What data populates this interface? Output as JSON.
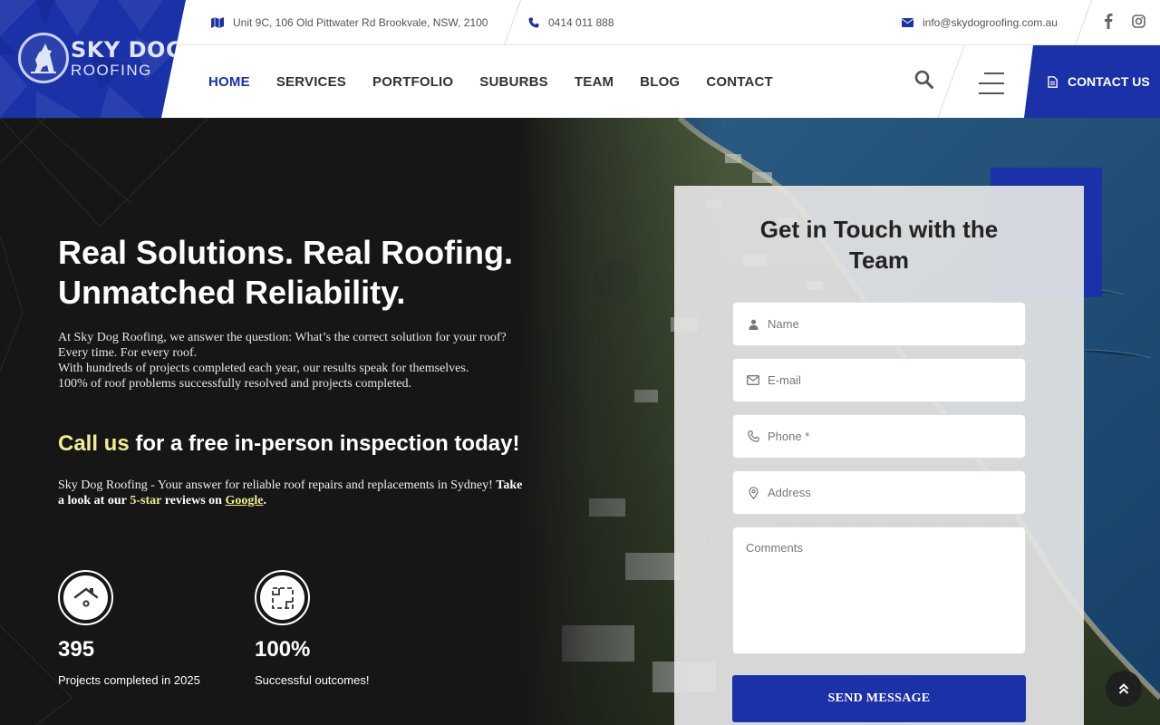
{
  "brand": {
    "line1": "SKY DOG",
    "line2": "ROOFING",
    "accent": "#1a31a8"
  },
  "topbar": {
    "address": "Unit 9C, 106 Old Pittwater Rd Brookvale, NSW, 2100",
    "phone": "0414 011 888",
    "email": "info@skydogroofing.com.au",
    "icons": {
      "address": "map-icon",
      "phone": "phone-icon",
      "email": "envelope-icon",
      "social": [
        "facebook-icon",
        "instagram-icon"
      ]
    }
  },
  "nav": {
    "items": [
      "HOME",
      "SERVICES",
      "PORTFOLIO",
      "SUBURBS",
      "TEAM",
      "BLOG",
      "CONTACT"
    ],
    "active": "HOME",
    "cta_label": "CONTACT US"
  },
  "hero": {
    "title_line1": "Real Solutions. Real Roofing.",
    "title_line2": "Unmatched Reliability.",
    "desc_lines": [
      "At Sky Dog Roofing, we answer the question: What’s the correct solution for your roof?",
      "Every time. For every roof.",
      "With hundreds of projects completed each year, our results speak for themselves.",
      "100% of roof problems successfully resolved and projects completed."
    ],
    "cta_highlight": "Call us",
    "cta_rest": "for a free in-person inspection today!",
    "note_plain": "Sky Dog Roofing - Your answer for reliable roof repairs and replacements in Sydney!",
    "note_bold_prefix": "Take a look at our",
    "note_stars": "5-star",
    "note_reviews_on": "reviews on",
    "note_link": "Google",
    "note_end": "."
  },
  "stats": [
    {
      "value": "395",
      "label": "Projects completed in 2025",
      "icon": "house-icon"
    },
    {
      "value": "100%",
      "label": "Successful outcomes!",
      "icon": "blueprint-icon"
    }
  ],
  "form": {
    "title_line1": "Get in Touch with the",
    "title_line2": "Team",
    "name_placeholder": "Name",
    "email_placeholder": "E-mail",
    "phone_placeholder": "Phone *",
    "address_placeholder": "Address",
    "comments_placeholder": "Comments",
    "submit_label": "SEND MESSAGE"
  }
}
